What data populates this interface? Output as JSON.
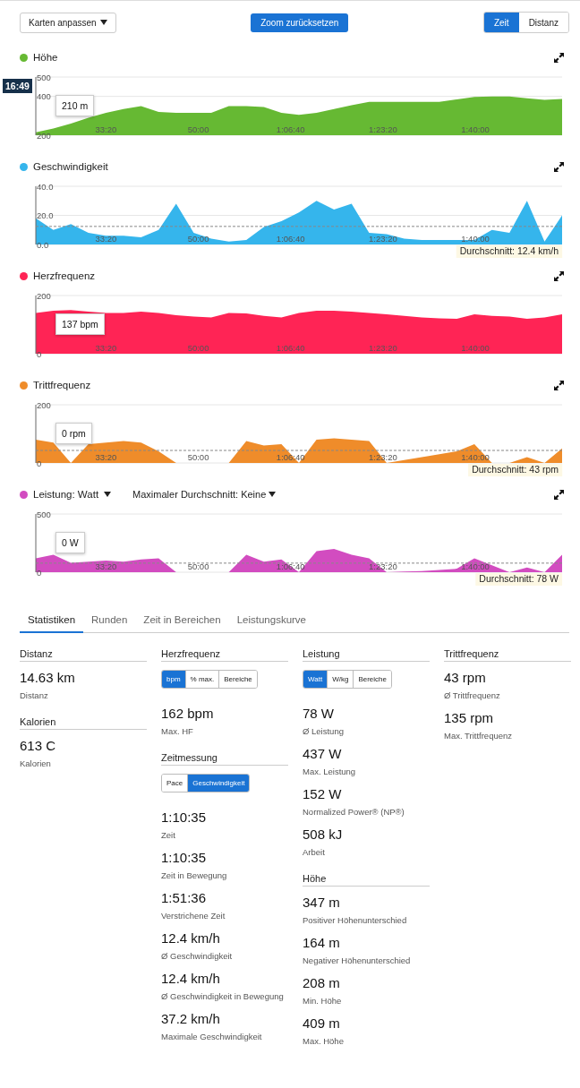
{
  "toolbar": {
    "customize_button": {
      "label": "Karten anpassen"
    },
    "reset_zoom_button": {
      "label": "Zoom zurücksetzen"
    },
    "axis_toggle": [
      {
        "label": "Zeit",
        "selected": true
      },
      {
        "label": "Distanz",
        "selected": false
      }
    ]
  },
  "charts": [
    {
      "cursor": {
        "time": "16:49",
        "value": "210 m"
      },
      "chart_data": {
        "type": "area",
        "title": "Höhe",
        "x": [
          1240,
          1430,
          1620,
          1810,
          2000,
          2190,
          2380,
          2570,
          2760,
          2950,
          3140,
          3330,
          3520,
          3710,
          3900,
          4090,
          4280,
          4470,
          4660,
          4850,
          5040,
          5230,
          5420,
          5610,
          5800,
          5990,
          6180,
          6370,
          6560,
          6750,
          6940
        ],
        "series": [
          {
            "color": "#66b933",
            "values": [
              215,
              235,
              260,
              290,
              315,
              335,
              350,
              320,
              315,
              315,
              315,
              350,
              350,
              345,
              315,
              305,
              315,
              335,
              355,
              372,
              372,
              372,
              372,
              372,
              385,
              397,
              400,
              400,
              390,
              383,
              387
            ]
          }
        ],
        "xlim": [
          1240,
          6940
        ],
        "ylim": [
          200,
          500
        ],
        "xticks": [
          {
            "value": 2000,
            "label": "33:20"
          },
          {
            "value": 3000,
            "label": "50:00"
          },
          {
            "value": 4000,
            "label": "1:06:40"
          },
          {
            "value": 5000,
            "label": "1:23:20"
          },
          {
            "value": 6000,
            "label": "1:40:00"
          }
        ],
        "yticks": [
          {
            "value": 500,
            "label": "500"
          },
          {
            "value": 400,
            "label": "400"
          },
          {
            "value": 200,
            "label": "200"
          }
        ]
      }
    },
    {
      "chart_data": {
        "type": "area",
        "title": "Geschwindigkeit",
        "x": [
          1240,
          1430,
          1620,
          1810,
          2000,
          2190,
          2380,
          2570,
          2760,
          2950,
          3140,
          3330,
          3520,
          3710,
          3900,
          4090,
          4280,
          4470,
          4660,
          4850,
          5040,
          5230,
          5420,
          5610,
          5800,
          5990,
          6180,
          6370,
          6560,
          6750,
          6940
        ],
        "series": [
          {
            "color": "#35b5ec",
            "values": [
              18,
              10,
              14,
              8,
              6,
              6,
              5,
              10,
              28,
              8,
              4,
              2,
              3,
              12,
              16,
              22,
              30,
              24,
              28,
              8,
              7,
              4,
              3,
              3,
              3,
              3,
              10,
              8,
              30,
              2,
              20
            ]
          }
        ],
        "xlim": [
          1240,
          6940
        ],
        "ylim": [
          0,
          40
        ],
        "xticks": [
          {
            "value": 2000,
            "label": "33:20"
          },
          {
            "value": 3000,
            "label": "50:00"
          },
          {
            "value": 4000,
            "label": "1:06:40"
          },
          {
            "value": 5000,
            "label": "1:23:20"
          },
          {
            "value": 6000,
            "label": "1:40:00"
          }
        ],
        "yticks": [
          {
            "value": 40,
            "label": "40.0"
          },
          {
            "value": 20,
            "label": "20.0"
          },
          {
            "value": 0,
            "label": "0.0"
          }
        ],
        "ref_lines": [
          {
            "axis": "y",
            "value": 12.4,
            "label": "Durchschnitt: 12.4 km/h"
          }
        ]
      }
    },
    {
      "cursor": {
        "value": "137 bpm"
      },
      "chart_data": {
        "type": "area",
        "title": "Herzfrequenz",
        "x": [
          1240,
          1430,
          1620,
          1810,
          2000,
          2190,
          2380,
          2570,
          2760,
          2950,
          3140,
          3330,
          3520,
          3710,
          3900,
          4090,
          4280,
          4470,
          4660,
          4850,
          5040,
          5230,
          5420,
          5610,
          5800,
          5990,
          6180,
          6370,
          6560,
          6750,
          6940
        ],
        "series": [
          {
            "color": "#ff2455",
            "values": [
              140,
              148,
              150,
              145,
              140,
              140,
              145,
              140,
              132,
              128,
              125,
              140,
              138,
              130,
              125,
              140,
              148,
              148,
              145,
              140,
              135,
              130,
              125,
              122,
              120,
              135,
              130,
              128,
              120,
              125,
              135
            ]
          }
        ],
        "xlim": [
          1240,
          6940
        ],
        "ylim": [
          0,
          200
        ],
        "xticks": [
          {
            "value": 2000,
            "label": "33:20"
          },
          {
            "value": 3000,
            "label": "50:00"
          },
          {
            "value": 4000,
            "label": "1:06:40"
          },
          {
            "value": 5000,
            "label": "1:23:20"
          },
          {
            "value": 6000,
            "label": "1:40:00"
          }
        ],
        "yticks": [
          {
            "value": 200,
            "label": "200"
          },
          {
            "value": 0,
            "label": "0"
          }
        ]
      }
    },
    {
      "cursor": {
        "value": "0 rpm"
      },
      "chart_data": {
        "type": "area",
        "title": "Trittfrequenz",
        "x": [
          1240,
          1430,
          1620,
          1810,
          2000,
          2190,
          2380,
          2570,
          2760,
          2950,
          3140,
          3330,
          3520,
          3710,
          3900,
          4090,
          4280,
          4470,
          4660,
          4850,
          5040,
          5230,
          5420,
          5610,
          5800,
          5990,
          6180,
          6370,
          6560,
          6750,
          6940
        ],
        "series": [
          {
            "color": "#ef8c2a",
            "values": [
              80,
              70,
              0,
              65,
              70,
              75,
              70,
              40,
              0,
              0,
              0,
              0,
              75,
              60,
              65,
              0,
              80,
              85,
              80,
              75,
              0,
              10,
              20,
              30,
              40,
              65,
              0,
              0,
              20,
              0,
              50
            ]
          }
        ],
        "xlim": [
          1240,
          6940
        ],
        "ylim": [
          0,
          200
        ],
        "xticks": [
          {
            "value": 2000,
            "label": "33:20"
          },
          {
            "value": 3000,
            "label": "50:00"
          },
          {
            "value": 4000,
            "label": "1:06:40"
          },
          {
            "value": 5000,
            "label": "1:23:20"
          },
          {
            "value": 6000,
            "label": "1:40:00"
          }
        ],
        "yticks": [
          {
            "value": 200,
            "label": "200"
          },
          {
            "value": 0,
            "label": "0"
          }
        ],
        "ref_lines": [
          {
            "axis": "y",
            "value": 43,
            "label": "Durchschnitt: 43 rpm"
          }
        ]
      }
    },
    {
      "title_dropdown": true,
      "filter_dropdown": {
        "label": "Maximaler Durchschnitt: Keine"
      },
      "cursor": {
        "value": "0 W"
      },
      "chart_data": {
        "type": "area",
        "title": "Leistung: Watt",
        "x": [
          1240,
          1430,
          1620,
          1810,
          2000,
          2190,
          2380,
          2570,
          2760,
          2950,
          3140,
          3330,
          3520,
          3710,
          3900,
          4090,
          4280,
          4470,
          4660,
          4850,
          5040,
          5230,
          5420,
          5610,
          5800,
          5990,
          6180,
          6370,
          6560,
          6750,
          6940
        ],
        "series": [
          {
            "color": "#d24cc0",
            "values": [
              120,
              150,
              80,
              90,
              100,
              90,
              110,
              120,
              0,
              0,
              0,
              0,
              150,
              90,
              110,
              0,
              180,
              200,
              150,
              120,
              0,
              5,
              10,
              20,
              30,
              120,
              60,
              0,
              40,
              0,
              150
            ]
          }
        ],
        "xlim": [
          1240,
          6940
        ],
        "ylim": [
          0,
          500
        ],
        "xticks": [
          {
            "value": 2000,
            "label": "33:20"
          },
          {
            "value": 3000,
            "label": "50:00"
          },
          {
            "value": 4000,
            "label": "1:06:40"
          },
          {
            "value": 5000,
            "label": "1:23:20"
          },
          {
            "value": 6000,
            "label": "1:40:00"
          }
        ],
        "yticks": [
          {
            "value": 500,
            "label": "500"
          },
          {
            "value": 0,
            "label": "0"
          }
        ],
        "ref_lines": [
          {
            "axis": "y",
            "value": 78,
            "label": "Durchschnitt: 78 W"
          }
        ]
      }
    }
  ],
  "tabs": [
    {
      "label": "Statistiken",
      "selected": true
    },
    {
      "label": "Runden",
      "selected": false
    },
    {
      "label": "Zeit in Bereichen",
      "selected": false
    },
    {
      "label": "Leistungskurve",
      "selected": false
    }
  ],
  "stats_columns": [
    {
      "sections": [
        {
          "title": "Distanz",
          "items": [
            {
              "value": "14.63 km",
              "label": "Distanz"
            }
          ]
        },
        {
          "title": "Kalorien",
          "items": [
            {
              "value": "613 C",
              "label": "Kalorien"
            }
          ]
        }
      ]
    },
    {
      "sections": [
        {
          "title": "Herzfrequenz",
          "toggle": [
            {
              "label": "bpm",
              "selected": true
            },
            {
              "label": "% max.",
              "selected": false
            },
            {
              "label": "Bereiche",
              "selected": false
            }
          ],
          "items": [
            {
              "value": "162 bpm",
              "label": "Max. HF"
            }
          ]
        },
        {
          "title": "Zeitmessung",
          "toggle": [
            {
              "label": "Pace",
              "selected": false
            },
            {
              "label": "Geschwindigkeit",
              "selected": true
            }
          ],
          "items": [
            {
              "value": "1:10:35",
              "label": "Zeit"
            },
            {
              "value": "1:10:35",
              "label": "Zeit in Bewegung"
            },
            {
              "value": "1:51:36",
              "label": "Verstrichene Zeit"
            },
            {
              "value": "12.4 km/h",
              "label": "Ø Geschwindigkeit"
            },
            {
              "value": "12.4 km/h",
              "label": "Ø Geschwindigkeit in Bewegung"
            },
            {
              "value": "37.2 km/h",
              "label": "Maximale Geschwindigkeit"
            }
          ]
        }
      ]
    },
    {
      "sections": [
        {
          "title": "Leistung",
          "toggle": [
            {
              "label": "Watt",
              "selected": true
            },
            {
              "label": "W/kg",
              "selected": false
            },
            {
              "label": "Bereiche",
              "selected": false
            }
          ],
          "items": [
            {
              "value": "78 W",
              "label": "Ø Leistung"
            },
            {
              "value": "437 W",
              "label": "Max. Leistung"
            },
            {
              "value": "152 W",
              "label": "Normalized Power® (NP®)"
            },
            {
              "value": "508 kJ",
              "label": "Arbeit"
            }
          ]
        },
        {
          "title": "Höhe",
          "items": [
            {
              "value": "347 m",
              "label": "Positiver Höhenunterschied"
            },
            {
              "value": "164 m",
              "label": "Negativer Höhenunterschied"
            },
            {
              "value": "208 m",
              "label": "Min. Höhe"
            },
            {
              "value": "409 m",
              "label": "Max. Höhe"
            }
          ]
        }
      ]
    },
    {
      "sections": [
        {
          "title": "Trittfrequenz",
          "items": [
            {
              "value": "43 rpm",
              "label": "Ø Trittfrequenz"
            },
            {
              "value": "135 rpm",
              "label": "Max. Trittfrequenz"
            }
          ]
        }
      ]
    }
  ]
}
